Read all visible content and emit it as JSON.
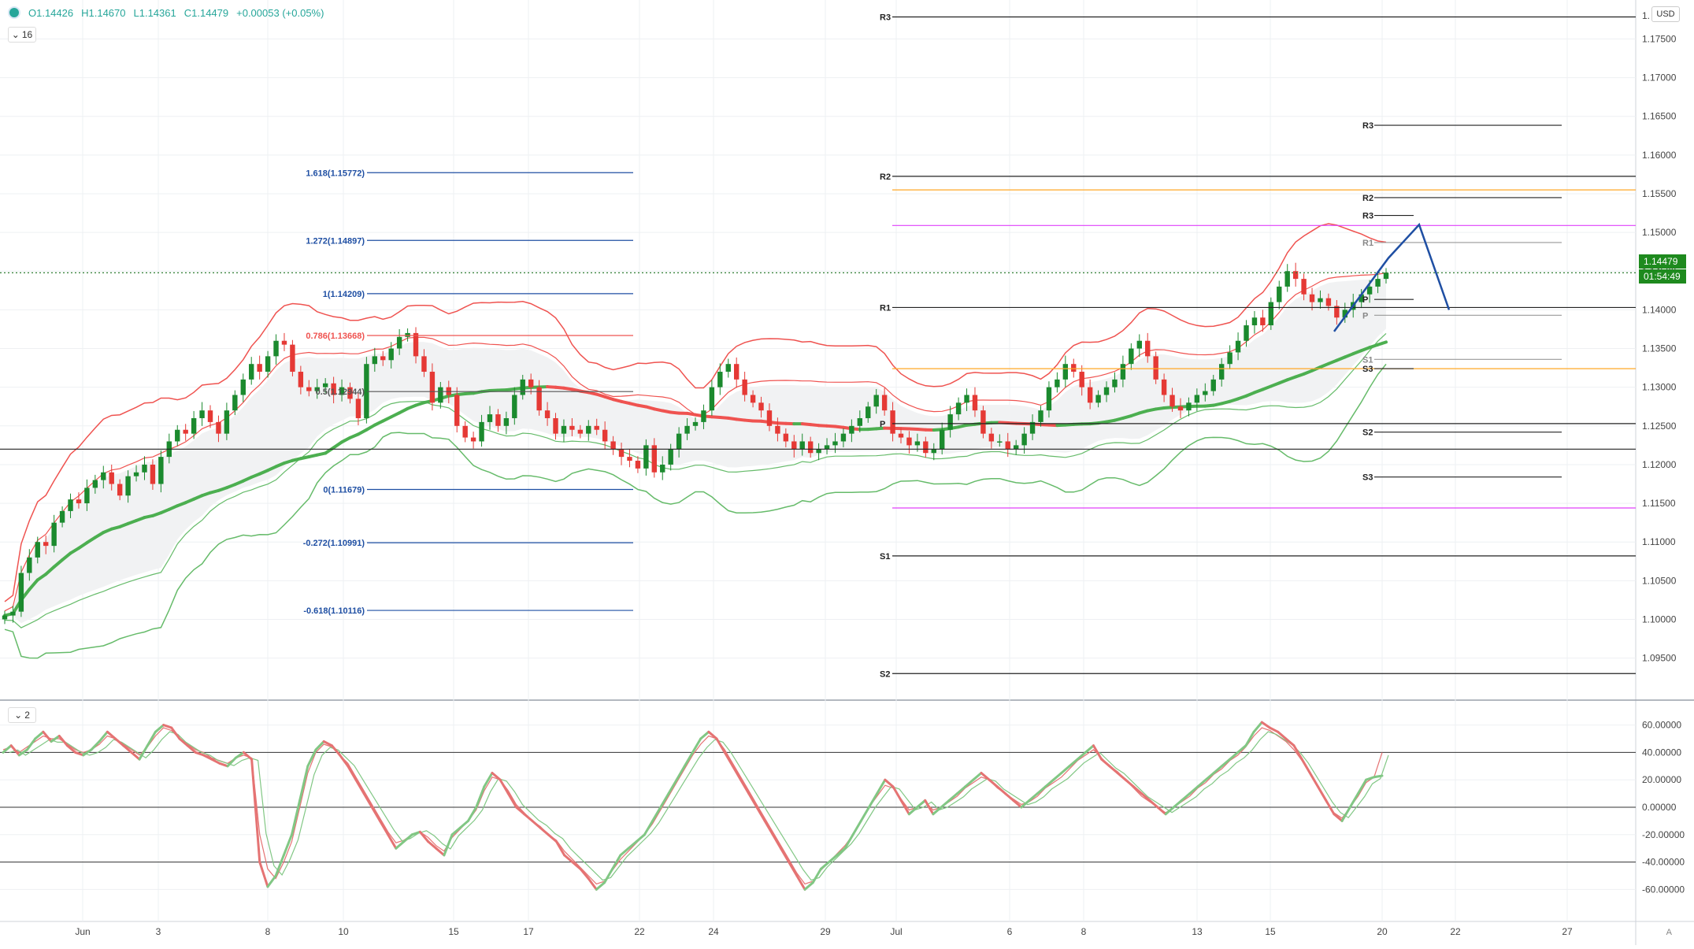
{
  "legend": {
    "open": "O1.14426",
    "high": "H1.14670",
    "low": "L1.14361",
    "close": "C1.14479",
    "change": "+0.00053 (+0.05%)"
  },
  "toolbar": {
    "collapse_main": "16",
    "collapse_osc": "2",
    "currency_label": "USD",
    "auto_label": "A"
  },
  "price_axis": {
    "ticks": [
      "1.17500",
      "1.17000",
      "1.16500",
      "1.16000",
      "1.15500",
      "1.15000",
      "1.14500",
      "1.14000",
      "1.13500",
      "1.13000",
      "1.12500",
      "1.12000",
      "1.11500",
      "1.11000",
      "1.10500",
      "1.10000",
      "1.09500"
    ],
    "top_partial": "1.",
    "last_price": "1.14479",
    "countdown": "01:54:49"
  },
  "osc_axis": {
    "ticks": [
      "60.00000",
      "40.00000",
      "20.00000",
      "0.00000",
      "-20.00000",
      "-40.00000",
      "-60.00000"
    ]
  },
  "time_axis": {
    "labels": [
      "Jun",
      "3",
      "8",
      "10",
      "15",
      "17",
      "22",
      "24",
      "29",
      "Jul",
      "6",
      "8",
      "13",
      "15",
      "20",
      "22",
      "27"
    ]
  },
  "fibonacci": [
    {
      "label": "1.618(1.15772)",
      "value": 1.15772
    },
    {
      "label": "1.272(1.14897)",
      "value": 1.14897
    },
    {
      "label": "1(1.14209)",
      "value": 1.14209
    },
    {
      "label": "0.786(1.13668)",
      "value": 1.13668
    },
    {
      "label": "0.5(1.12944)",
      "value": 1.12944
    },
    {
      "label": "0(1.11679)",
      "value": 1.11679
    },
    {
      "label": "-0.272(1.10991)",
      "value": 1.10991
    },
    {
      "label": "-0.618(1.10116)",
      "value": 1.10116
    }
  ],
  "pivots_monthly": [
    {
      "label": "R3",
      "value": 1.17785
    },
    {
      "label": "R2",
      "value": 1.15725
    },
    {
      "label": "R1",
      "value": 1.1403
    },
    {
      "label": "P",
      "value": 1.1253
    },
    {
      "label": "S1",
      "value": 1.1082
    },
    {
      "label": "S2",
      "value": 1.093
    }
  ],
  "pivots_weekly": [
    {
      "label": "R3",
      "value": 1.16385
    },
    {
      "label": "R2",
      "value": 1.1545
    },
    {
      "label": "R3",
      "value": 1.1522
    },
    {
      "label": "R1",
      "value": 1.1487
    },
    {
      "label": "P",
      "value": 1.14135
    },
    {
      "label": "P",
      "value": 1.1393
    },
    {
      "label": "S1",
      "value": 1.1336
    },
    {
      "label": "S3",
      "value": 1.1324
    },
    {
      "label": "S2",
      "value": 1.1242
    },
    {
      "label": "S3",
      "value": 1.1184
    }
  ],
  "horizontal_lines": [
    {
      "value": 1.1509,
      "color": "#e040fb"
    },
    {
      "value": 1.1144,
      "color": "#e040fb"
    },
    {
      "value": 1.1555,
      "color": "#ffa726"
    },
    {
      "value": 1.1324,
      "color": "#ffa726"
    },
    {
      "value": 1.14479,
      "color": "#2e7d32"
    },
    {
      "value": 1.122,
      "color": "#222222"
    }
  ],
  "chart_data": {
    "type": "candlestick",
    "y_range": [
      1.0915,
      1.178
    ],
    "candles_close": [
      1.1005,
      1.101,
      1.106,
      1.108,
      1.11,
      1.1095,
      1.1125,
      1.114,
      1.1155,
      1.115,
      1.117,
      1.118,
      1.119,
      1.1175,
      1.116,
      1.1185,
      1.119,
      1.12,
      1.1175,
      1.121,
      1.123,
      1.1245,
      1.124,
      1.126,
      1.127,
      1.1255,
      1.124,
      1.127,
      1.129,
      1.131,
      1.133,
      1.132,
      1.134,
      1.136,
      1.1355,
      1.132,
      1.13,
      1.1295,
      1.13,
      1.1305,
      1.129,
      1.13,
      1.1285,
      1.126,
      1.133,
      1.134,
      1.1335,
      1.135,
      1.1365,
      1.137,
      1.134,
      1.132,
      1.128,
      1.13,
      1.129,
      1.125,
      1.1235,
      1.123,
      1.1255,
      1.1265,
      1.125,
      1.126,
      1.129,
      1.131,
      1.13,
      1.127,
      1.126,
      1.124,
      1.125,
      1.1245,
      1.124,
      1.125,
      1.1245,
      1.123,
      1.122,
      1.121,
      1.1205,
      1.1195,
      1.1225,
      1.119,
      1.12,
      1.122,
      1.124,
      1.125,
      1.1255,
      1.127,
      1.13,
      1.132,
      1.133,
      1.131,
      1.129,
      1.128,
      1.127,
      1.125,
      1.124,
      1.123,
      1.122,
      1.123,
      1.1215,
      1.122,
      1.1225,
      1.123,
      1.124,
      1.125,
      1.126,
      1.1275,
      1.129,
      1.127,
      1.124,
      1.1235,
      1.1225,
      1.123,
      1.1215,
      1.122,
      1.1245,
      1.1265,
      1.128,
      1.129,
      1.127,
      1.124,
      1.123,
      1.123,
      1.122,
      1.1225,
      1.124,
      1.1255,
      1.127,
      1.13,
      1.131,
      1.133,
      1.132,
      1.13,
      1.128,
      1.129,
      1.13,
      1.131,
      1.133,
      1.135,
      1.136,
      1.134,
      1.131,
      1.129,
      1.1275,
      1.127,
      1.128,
      1.129,
      1.1295,
      1.131,
      1.133,
      1.1345,
      1.136,
      1.138,
      1.139,
      1.138,
      1.141,
      1.143,
      1.145,
      1.144,
      1.142,
      1.141,
      1.1415,
      1.1405,
      1.139,
      1.14,
      1.141,
      1.142,
      1.143,
      1.144,
      1.1448
    ],
    "trend_projection": [
      1.1372,
      1.1467,
      1.151,
      1.14
    ],
    "oscillator_main": [
      40,
      45,
      38,
      42,
      50,
      55,
      48,
      52,
      45,
      40,
      38,
      42,
      48,
      55,
      50,
      45,
      40,
      35,
      45,
      55,
      60,
      58,
      50,
      45,
      40,
      38,
      35,
      32,
      30,
      36,
      40,
      35,
      -40,
      -58,
      -50,
      -35,
      -20,
      5,
      30,
      42,
      48,
      45,
      38,
      30,
      20,
      10,
      0,
      -10,
      -20,
      -30,
      -25,
      -20,
      -18,
      -25,
      -30,
      -35,
      -20,
      -15,
      -10,
      0,
      15,
      25,
      20,
      10,
      0,
      -5,
      -10,
      -15,
      -20,
      -25,
      -35,
      -40,
      -45,
      -52,
      -60,
      -55,
      -45,
      -35,
      -30,
      -25,
      -20,
      -10,
      0,
      10,
      20,
      30,
      40,
      50,
      55,
      50,
      40,
      30,
      20,
      10,
      0,
      -10,
      -20,
      -30,
      -40,
      -50,
      -60,
      -55,
      -45,
      -40,
      -35,
      -30,
      -20,
      -10,
      0,
      10,
      20,
      15,
      5,
      -5,
      0,
      5,
      -5,
      0,
      5,
      10,
      15,
      20,
      25,
      20,
      15,
      10,
      5,
      0,
      5,
      10,
      15,
      20,
      25,
      30,
      35,
      40,
      45,
      35,
      30,
      25,
      20,
      15,
      10,
      5,
      0,
      -5,
      0,
      5,
      10,
      15,
      20,
      25,
      30,
      35,
      40,
      45,
      55,
      62,
      58,
      55,
      50,
      45,
      35,
      25,
      15,
      5,
      -5,
      -10,
      0,
      10,
      20,
      22,
      23
    ],
    "oscillator_signal": [
      42,
      44,
      40,
      44,
      48,
      52,
      50,
      50,
      46,
      42,
      40,
      42,
      46,
      52,
      50,
      46,
      42,
      38,
      44,
      52,
      58,
      56,
      50,
      46,
      42,
      40,
      36,
      34,
      32,
      36,
      38,
      36,
      -20,
      -45,
      -52,
      -40,
      -25,
      0,
      25,
      40,
      46,
      44,
      38,
      32,
      22,
      12,
      2,
      -8,
      -18,
      -26,
      -24,
      -20,
      -18,
      -22,
      -28,
      -32,
      -22,
      -16,
      -10,
      -2,
      12,
      22,
      20,
      12,
      2,
      -4,
      -10,
      -14,
      -20,
      -24,
      -32,
      -38,
      -44,
      -50,
      -56,
      -54,
      -46,
      -38,
      -32,
      -26,
      -20,
      -12,
      -2,
      8,
      18,
      28,
      38,
      46,
      52,
      50,
      42,
      32,
      22,
      12,
      2,
      -8,
      -18,
      -28,
      -38,
      -48,
      -56,
      -54,
      -46,
      -40,
      -34,
      -28,
      -20,
      -10,
      0,
      8,
      16,
      14,
      6,
      -2,
      0,
      4,
      -2,
      0,
      4,
      8,
      14,
      18,
      22,
      20,
      14,
      10,
      6,
      2,
      4,
      8,
      14,
      18,
      22,
      28,
      34,
      38,
      42,
      36,
      30,
      26,
      20,
      14,
      8,
      4,
      0,
      -4,
      0,
      4,
      8,
      14,
      18,
      24,
      28,
      34,
      38,
      44,
      52,
      58,
      56,
      52,
      48,
      42,
      34,
      24,
      14,
      4,
      -4,
      -8,
      0,
      8,
      18,
      22,
      40
    ]
  }
}
